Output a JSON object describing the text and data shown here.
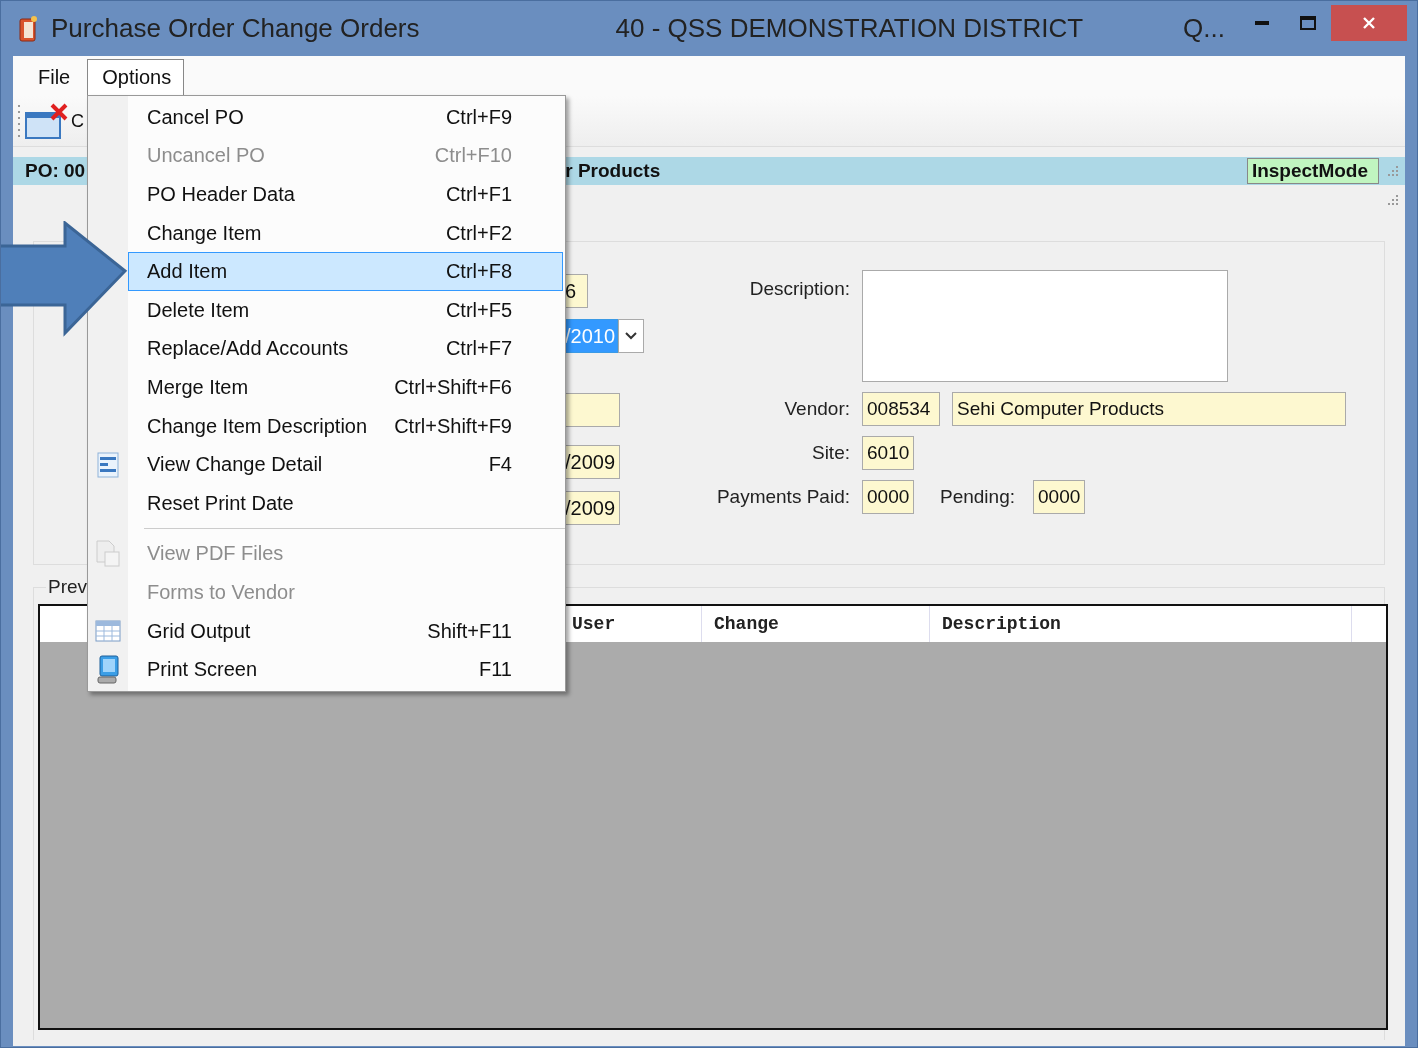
{
  "window": {
    "title": "Purchase Order Change Orders",
    "district": "40 - QSS DEMONSTRATION DISTRICT",
    "user": "Q..."
  },
  "menu_bar": [
    {
      "label": "File",
      "selected": false
    },
    {
      "label": "Options",
      "selected": true
    }
  ],
  "toolbar": {
    "button": "C"
  },
  "po_bar": {
    "po": "PO: 00",
    "vendor": "r Products",
    "mode": "InspectMode"
  },
  "options_menu": [
    {
      "kind": "item",
      "label": "Cancel PO",
      "shortcut": "Ctrl+F9",
      "disabled": false,
      "selected": false
    },
    {
      "kind": "item",
      "label": "Uncancel PO",
      "shortcut": "Ctrl+F10",
      "disabled": true,
      "selected": false
    },
    {
      "kind": "item",
      "label": "PO Header Data",
      "shortcut": "Ctrl+F1",
      "disabled": false,
      "selected": false
    },
    {
      "kind": "item",
      "label": "Change Item",
      "shortcut": "Ctrl+F2",
      "disabled": false,
      "selected": false
    },
    {
      "kind": "item",
      "label": "Add Item",
      "shortcut": "Ctrl+F8",
      "disabled": false,
      "selected": true
    },
    {
      "kind": "item",
      "label": "Delete Item",
      "shortcut": "Ctrl+F5",
      "disabled": false,
      "selected": false
    },
    {
      "kind": "item",
      "label": "Replace/Add Accounts",
      "shortcut": "Ctrl+F7",
      "disabled": false,
      "selected": false
    },
    {
      "kind": "item",
      "label": "Merge Item",
      "shortcut": "Ctrl+Shift+F6",
      "disabled": false,
      "selected": false
    },
    {
      "kind": "item",
      "label": "Change Item Description",
      "shortcut": "Ctrl+Shift+F9",
      "disabled": false,
      "selected": false
    },
    {
      "kind": "item",
      "label": "View Change Detail",
      "shortcut": "F4",
      "disabled": false,
      "selected": false
    },
    {
      "kind": "item",
      "label": "Reset Print Date",
      "disabled": false,
      "selected": false
    },
    {
      "kind": "separator"
    },
    {
      "kind": "item",
      "label": "View PDF Files",
      "disabled": true,
      "selected": false
    },
    {
      "kind": "item",
      "label": "Forms to Vendor",
      "disabled": true,
      "selected": false
    },
    {
      "kind": "item",
      "label": "Grid Output",
      "shortcut": "Shift+F11",
      "disabled": false,
      "selected": false
    },
    {
      "kind": "item",
      "label": "Print Screen",
      "shortcut": "F11",
      "disabled": false,
      "selected": false
    }
  ],
  "left_fields": [
    {
      "kind": "text",
      "value": "6",
      "selected": false
    },
    {
      "kind": "dropdown",
      "value": "/2010",
      "selected": true
    },
    {
      "kind": "text",
      "selected": false
    },
    {
      "kind": "text",
      "value": "/2009",
      "selected": false
    },
    {
      "kind": "text",
      "value": "/2009",
      "selected": false
    }
  ],
  "description": {
    "label": "Description:"
  },
  "vendor": {
    "label": "Vendor:",
    "code": "008534",
    "name": "Sehi Computer Products"
  },
  "site": {
    "label": "Site:",
    "value": "6010"
  },
  "payments_paid": {
    "label": "Payments Paid:",
    "value": "0000"
  },
  "pending": {
    "label": "Pending:",
    "value": "0000"
  },
  "history": {
    "label": "Prev",
    "columns": [
      "User",
      "Change",
      "Description"
    ]
  }
}
